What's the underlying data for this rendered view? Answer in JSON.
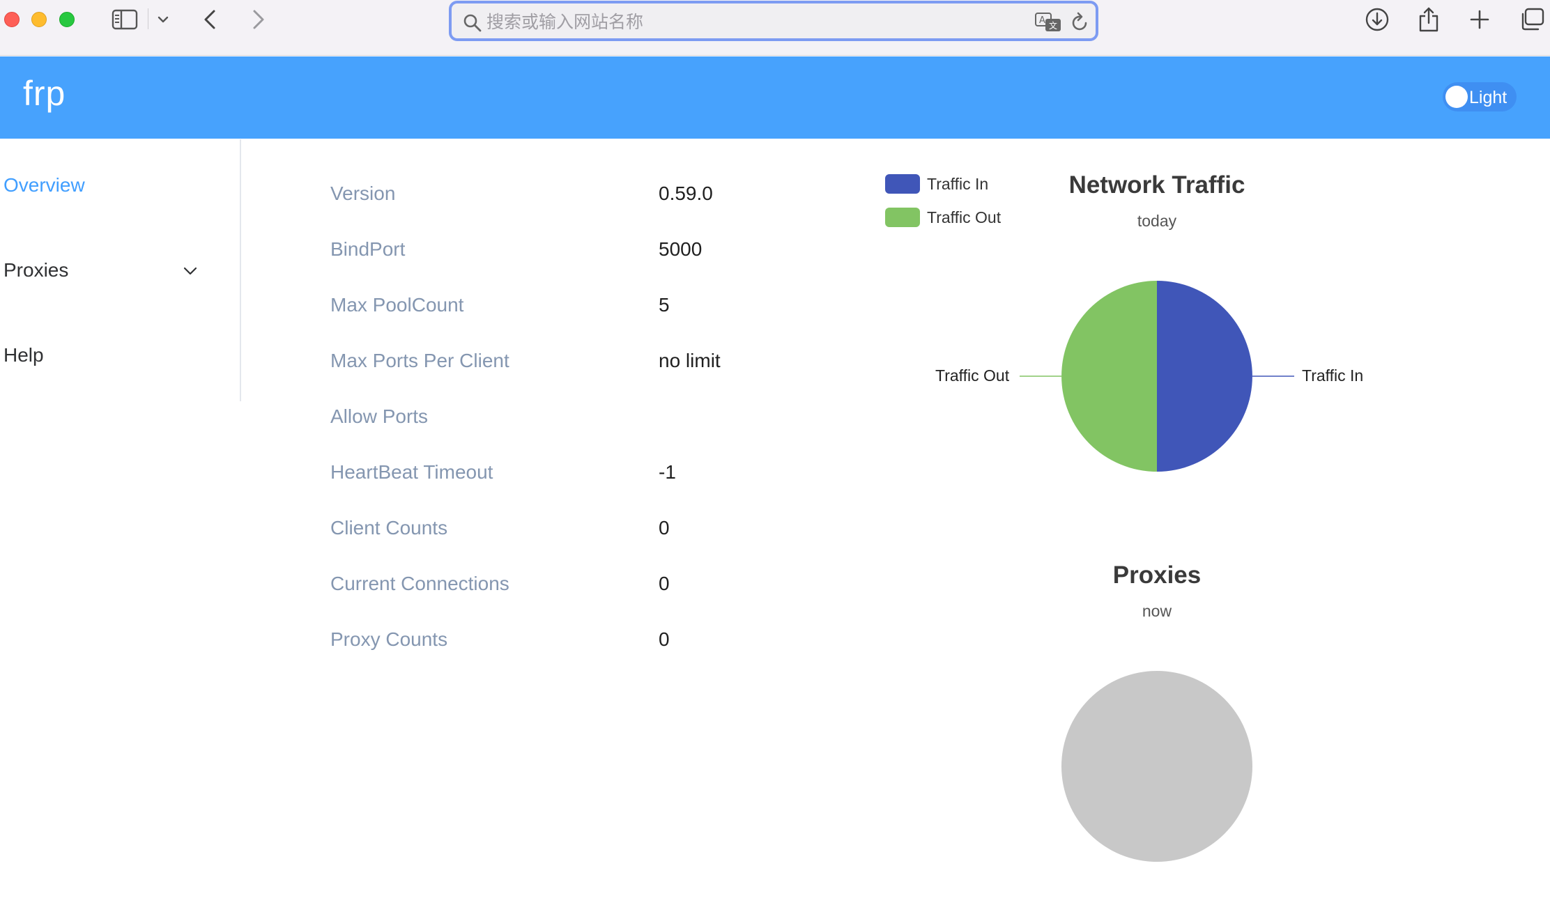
{
  "browser": {
    "address_placeholder": "搜索或输入网站名称"
  },
  "header": {
    "brand": "frp",
    "theme_toggle_label": "Light"
  },
  "sidebar": {
    "items": [
      {
        "label": "Overview",
        "active": true
      },
      {
        "label": "Proxies",
        "active": false
      },
      {
        "label": "Help",
        "active": false
      }
    ]
  },
  "overview": {
    "rows": [
      {
        "label": "Version",
        "value": "0.59.0"
      },
      {
        "label": "BindPort",
        "value": "5000"
      },
      {
        "label": "Max PoolCount",
        "value": "5"
      },
      {
        "label": "Max Ports Per Client",
        "value": "no limit"
      },
      {
        "label": "Allow Ports",
        "value": ""
      },
      {
        "label": "HeartBeat Timeout",
        "value": "-1"
      },
      {
        "label": "Client Counts",
        "value": "0"
      },
      {
        "label": "Current Connections",
        "value": "0"
      },
      {
        "label": "Proxy Counts",
        "value": "0"
      }
    ]
  },
  "chart_data": [
    {
      "type": "pie",
      "title": "Network Traffic",
      "subtitle": "today",
      "legend": [
        "Traffic In",
        "Traffic Out"
      ],
      "legend_position": "top-left",
      "slices": [
        {
          "name": "Traffic In",
          "value": 50,
          "color": "#4056b8"
        },
        {
          "name": "Traffic Out",
          "value": 50,
          "color": "#82c463"
        }
      ]
    },
    {
      "type": "pie",
      "title": "Proxies",
      "subtitle": "now",
      "slices": [],
      "empty_color": "#c8c8c8"
    }
  ],
  "colors": {
    "header_bg": "#47a2fd",
    "active_nav": "#409eff",
    "label_text": "#8496b0"
  }
}
